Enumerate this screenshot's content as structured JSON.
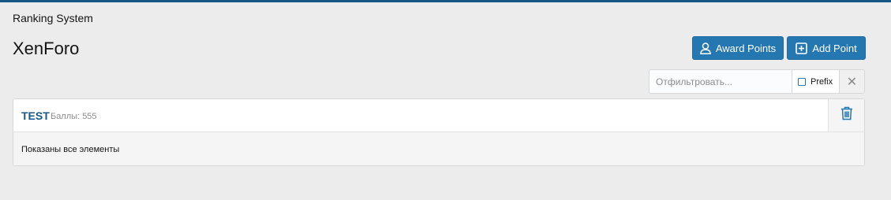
{
  "breadcrumb": "Ranking System",
  "page_title": "XenForo",
  "buttons": {
    "award_points": "Award Points",
    "add_point": "Add Point"
  },
  "filter": {
    "placeholder": "Отфильтровать...",
    "prefix_label": "Prefix",
    "clear_glyph": "✕"
  },
  "list": {
    "items": [
      {
        "title": "TEST",
        "hint": "Баллы: 555"
      }
    ],
    "footer": "Показаны все элементы"
  },
  "icons": {
    "award_points": "user-icon",
    "add_point": "plus-square-icon",
    "delete": "trash-icon"
  },
  "colors": {
    "accent": "#2577b1",
    "title_link": "#185886",
    "top_bar": "#185886"
  }
}
